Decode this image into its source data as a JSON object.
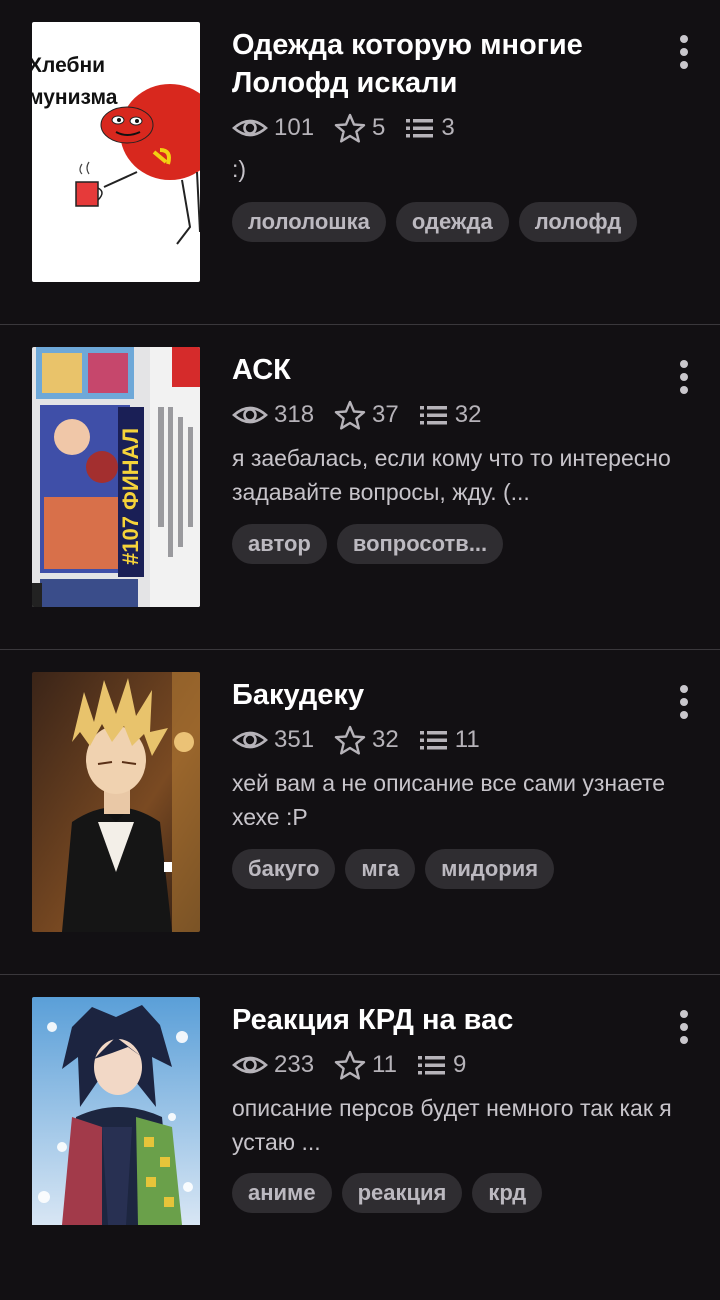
{
  "stories": [
    {
      "title": "Одежда которую многие Лолофд искали",
      "cover_text": [
        "Хлебни",
        "мунизма"
      ],
      "views": "101",
      "stars": "5",
      "chapters": "3",
      "description": ":)",
      "tags": [
        "лололошка",
        "одежда",
        "лолофд"
      ]
    },
    {
      "title": "АСК",
      "cover_text": [
        "#107 ФИНАЛ"
      ],
      "views": "318",
      "stars": "37",
      "chapters": "32",
      "description": "я заебалась, если кому что то интересно задавайте вопросы, жду. (...",
      "tags": [
        "автор",
        "вопросотв..."
      ]
    },
    {
      "title": "Бакудеку",
      "views": "351",
      "stars": "32",
      "chapters": "11",
      "description": "хей вам а не описание все сами узнаете хехе :P",
      "tags": [
        "бакуго",
        "мга",
        "мидория"
      ]
    },
    {
      "title": "Реакция КРД на вас",
      "views": "233",
      "stars": "11",
      "chapters": "9",
      "description": "описание персов будет немного так как я устаю ...",
      "tags": [
        "аниме",
        "реакция",
        "крд"
      ]
    }
  ],
  "icons": {
    "views": "eye-icon",
    "stars": "star-icon",
    "chapters": "list-icon",
    "menu": "more-vertical-icon"
  },
  "colors": {
    "background": "#121013",
    "tag_background": "#2f2d31",
    "secondary_text": "#b6b3b9"
  }
}
